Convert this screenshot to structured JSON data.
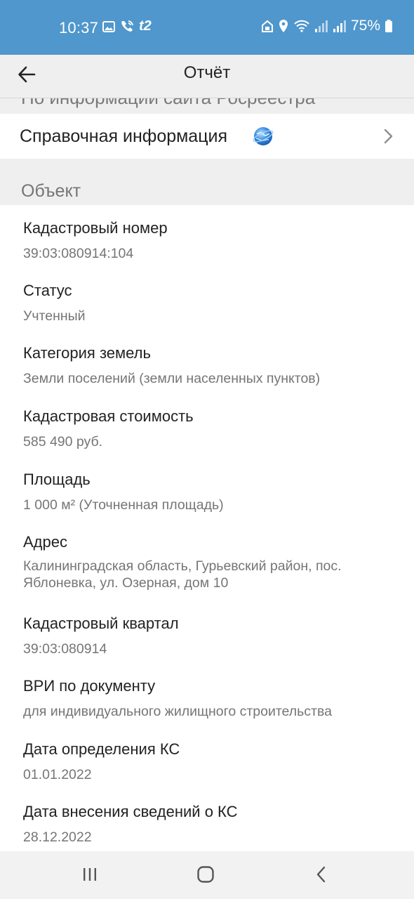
{
  "status_bar": {
    "time": "10:37",
    "carrier": "t2",
    "battery": "75%",
    "icons": [
      "gallery-icon",
      "wifi-call-icon",
      "carrier-icon",
      "lock-home-icon",
      "location-icon",
      "wifi-icon",
      "signal-icon",
      "signal-icon",
      "battery-icon"
    ]
  },
  "app_bar": {
    "title": "Отчёт",
    "back_icon": "arrow-left-icon"
  },
  "clipped_header": "По информации сайта Росреестра",
  "reference_row": {
    "label": "Справочная информация",
    "icon": "globe-icon",
    "chevron": "chevron-right-icon"
  },
  "section_title": "Объект",
  "fields": [
    {
      "label": "Кадастровый номер",
      "value": "39:03:080914:104"
    },
    {
      "label": "Статус",
      "value": "Учтенный"
    },
    {
      "label": "Категория земель",
      "value": "Земли поселений (земли населенных пунктов)"
    },
    {
      "label": "Кадастровая стоимость",
      "value": "585 490 руб."
    },
    {
      "label": "Площадь",
      "value": "1 000 м² (Уточненная площадь)"
    },
    {
      "label": "Адрес",
      "value_line1": "Калининградская область, Гурьевский район, пос.",
      "value_line2": "Яблоневка, ул. Озерная, дом 10"
    },
    {
      "label": "Кадастровый квартал",
      "value": "39:03:080914"
    },
    {
      "label": "ВРИ по документу",
      "value": "для индивидуального жилищного строительства"
    },
    {
      "label": "Дата определения КС",
      "value": "01.01.2022"
    },
    {
      "label": "Дата внесения сведений о КС",
      "value": "28.12.2022"
    }
  ],
  "nav_bar": {
    "buttons": [
      "recent-apps-icon",
      "home-icon",
      "back-icon"
    ]
  },
  "colors": {
    "status_bar": "#4f97cc",
    "app_bar": "#efefef",
    "label_text": "#222222",
    "value_text": "#757575"
  }
}
